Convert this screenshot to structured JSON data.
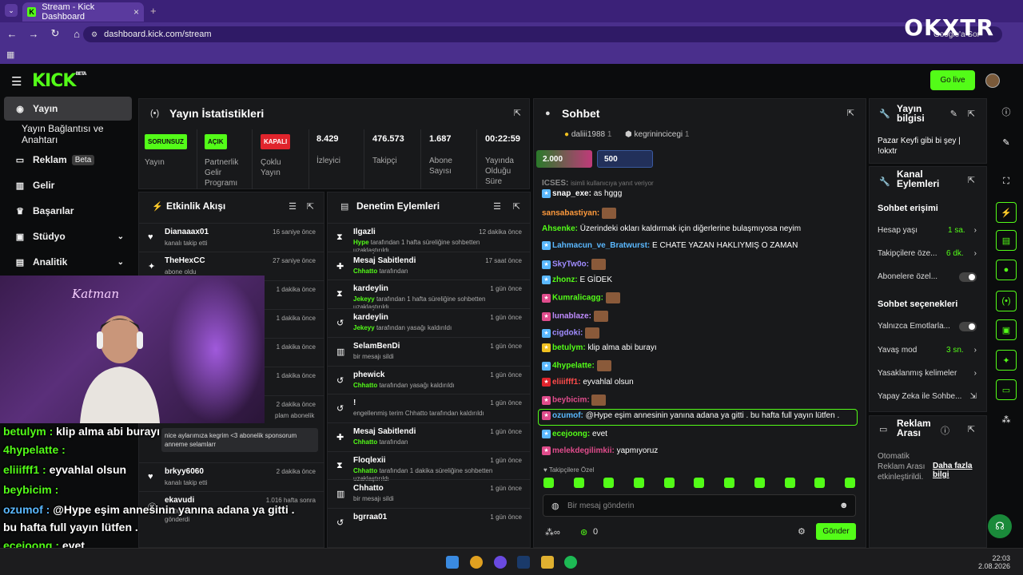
{
  "browser": {
    "tab_title": "Stream - Kick Dashboard",
    "url": "dashboard.kick.com/stream",
    "google_search": "Google'a Sor",
    "watermark": "OKXTR"
  },
  "header": {
    "logo": "KICK",
    "logo_beta": "BETA",
    "golive": "Go live"
  },
  "sidebar": {
    "items": [
      {
        "label": "Yayın",
        "icon": "broadcast-icon",
        "active": true
      },
      {
        "label": "Yayın Bağlantısı ve Anahtarı"
      },
      {
        "label": "Reklam",
        "icon": "ad-icon",
        "badge": "Beta"
      },
      {
        "label": "Gelir",
        "icon": "chart-icon"
      },
      {
        "label": "Başarılar",
        "icon": "trophy-icon"
      },
      {
        "label": "Stüdyo",
        "icon": "studio-icon"
      },
      {
        "label": "Analitik",
        "icon": "analytics-icon"
      }
    ]
  },
  "stats": {
    "title": "Yayın İstatistikleri",
    "items": [
      {
        "value": "SORUNSUZ",
        "label": "Yayın",
        "color": "#53fc18"
      },
      {
        "value": "AÇIK",
        "label": "Partnerlik Gelir Programı",
        "color": "#53fc18"
      },
      {
        "value": "KAPALI",
        "label": "Çoklu Yayın",
        "color": "#e0242c"
      },
      {
        "value": "8.429",
        "label": "İzleyici"
      },
      {
        "value": "476.573",
        "label": "Takipçi"
      },
      {
        "value": "1.687",
        "label": "Abone Sayısı"
      },
      {
        "value": "00:22:59",
        "label": "Yayında Olduğu Süre"
      }
    ]
  },
  "activity": {
    "title": "Etkinlik Akışı",
    "rows": [
      {
        "name": "Dianaaax01",
        "sub": "kanalı takip etti",
        "time": "16 saniye önce"
      },
      {
        "name": "TheHexCC",
        "sub": "abone oldu",
        "time": "27 saniye önce"
      },
      {
        "name": "",
        "sub": "",
        "time": "1 dakika önce"
      },
      {
        "name": "",
        "sub": "",
        "time": "1 dakika önce"
      },
      {
        "name": "",
        "sub": "",
        "time": "1 dakika önce"
      },
      {
        "name": "",
        "sub": "",
        "time": "1 dakika önce"
      },
      {
        "name": "",
        "sub": "plam abonelik",
        "time": "2 dakika önce"
      }
    ],
    "gift_msg": "nice aylarımıza kegrim <3 abonelik sponsorum anneme selamlarr",
    "rows2": [
      {
        "name": "brkyy6060",
        "sub": "kanalı takip etti",
        "time": "2 dakika önce"
      },
      {
        "name": "ekavudi",
        "sub": "2.000 gönderdi",
        "time": "1.016 hafta sonra"
      }
    ]
  },
  "moderation": {
    "title": "Denetim Eylemleri",
    "rows": [
      {
        "name": "Ilgazli",
        "actor": "Hype",
        "sub": "tarafından 1 hafta süreliğine sohbetten uzaklaştırıldı",
        "time": "12 dakika önce",
        "icon": "hourglass-icon"
      },
      {
        "name": "Mesaj Sabitlendi",
        "actor": "Chhatto",
        "sub": "tarafından",
        "time": "17 saat önce",
        "icon": "pin-icon"
      },
      {
        "name": "kardeylin",
        "actor": "Jekeyy",
        "sub": "tarafından 1 hafta süreliğine sohbetten uzaklaştırıldı",
        "time": "1 gün önce",
        "icon": "hourglass-icon"
      },
      {
        "name": "kardeylin",
        "actor": "Jekeyy",
        "sub": "tarafından yasağı kaldırıldı",
        "time": "1 gün önce",
        "icon": "undo-icon"
      },
      {
        "name": "SelamBenDi",
        "actor": "",
        "sub": "bir mesajı sildi",
        "time": "1 gün önce",
        "icon": "trash-icon"
      },
      {
        "name": "phewick",
        "actor": "Chhatto",
        "sub": "tarafından yasağı kaldırıldı",
        "time": "1 gün önce",
        "icon": "undo-icon"
      },
      {
        "name": "!",
        "actor": "",
        "sub": "engellenmiş terim Chhatto tarafından kaldırıldı",
        "time": "1 gün önce",
        "icon": "undo-icon"
      },
      {
        "name": "Mesaj Sabitlendi",
        "actor": "Chhatto",
        "sub": "tarafından",
        "time": "1 gün önce",
        "icon": "pin-icon"
      },
      {
        "name": "Floqlexii",
        "actor": "Chhatto",
        "sub": "tarafından 1 dakika süreliğine sohbetten uzaklaştırıldı",
        "time": "1 gün önce",
        "icon": "hourglass-icon"
      },
      {
        "name": "Chhatto",
        "actor": "",
        "sub": "bir mesajı sildi",
        "time": "1 gün önce",
        "icon": "trash-icon"
      },
      {
        "name": "bgrraa01",
        "actor": "",
        "sub": "",
        "time": "1 gün önce",
        "icon": "undo-icon"
      }
    ]
  },
  "chat": {
    "title": "Sohbet",
    "top_users": [
      {
        "name": "daliii1988",
        "count": "1"
      },
      {
        "name": "kegrinincicegi",
        "count": "1"
      }
    ],
    "goals": [
      {
        "value": "2.000"
      },
      {
        "value": "500"
      }
    ],
    "reply_note": "isimli kullanıcıya yanıt veriyor",
    "messages": [
      {
        "user": "ICSES:",
        "text": "",
        "color": "#888"
      },
      {
        "user": "snap_exe:",
        "text": "as hggg",
        "color": "#fff",
        "badge": "#5ab8ff"
      },
      {
        "user": "sansabastiyan:",
        "text": "",
        "color": "#ff9a3c",
        "emote": true
      },
      {
        "user": "Ahsenke:",
        "text": "Üzerindeki okları kaldırmak için diğerlerine bulaşmıyosa neyim",
        "color": "#53fc18"
      },
      {
        "user": "Lahmacun_ve_Bratwurst:",
        "text": "E CHATE YAZAN HAKLIYMIŞ O ZAMAN",
        "color": "#5ab8ff",
        "badge": "#5ab8ff"
      },
      {
        "user": "SkyTw0o:",
        "text": "",
        "color": "#a08cff",
        "badge": "#5ab8ff",
        "emote": true
      },
      {
        "user": "zhonz:",
        "text": "E GİDEK",
        "color": "#53fc18",
        "badge": "#5ab8ff"
      },
      {
        "user": "Kumralicagg:",
        "text": "",
        "color": "#53fc18",
        "badge": "#e04c8c",
        "emote": true
      },
      {
        "user": "lunablaze:",
        "text": "",
        "color": "#c08cff",
        "badge": "#e04c8c",
        "emote": true
      },
      {
        "user": "cigdoki:",
        "text": "",
        "color": "#a08cff",
        "badge": "#5ab8ff",
        "emote": true
      },
      {
        "user": "betulym:",
        "text": "klip alma abi burayı",
        "color": "#53fc18",
        "badge": "#f0c020"
      },
      {
        "user": "4hypelatte:",
        "text": "",
        "color": "#53fc18",
        "badge": "#5ab8ff",
        "emote": true
      },
      {
        "user": "eliiifff1:",
        "text": "eyvahlal olsun",
        "color": "#ff4c4c",
        "badge": "#e0242c"
      },
      {
        "user": "beybicim:",
        "text": "",
        "color": "#e04c8c",
        "badge": "#e04c8c",
        "emote": true
      },
      {
        "user": "ozumof:",
        "text": "@Hype eşim annesinin yanına adana ya gitti . bu hafta full yayın lütfen .",
        "color": "#5ab8ff",
        "badge": "#e04c8c",
        "highlight": true
      },
      {
        "user": "ecejoong:",
        "text": "evet",
        "color": "#53fc18",
        "badge": "#5ab8ff"
      },
      {
        "user": "melekdegilimkii:",
        "text": "yapmıyoruz",
        "color": "#e04c8c",
        "badge": "#e04c8c"
      }
    ],
    "follower_only": "Takipçilere Özel",
    "input_placeholder": "Bir mesaj gönderin",
    "points": "0",
    "send": "Gönder"
  },
  "stream_info": {
    "title": "Yayın bilgisi",
    "text": "Pazar Keyfi gibi bi şey | !okxtr"
  },
  "channel_actions": {
    "title": "Kanal Eylemleri",
    "access_head": "Sohbet erişimi",
    "access": [
      {
        "label": "Hesap yaşı",
        "value": "1 sa.",
        "kind": "chev"
      },
      {
        "label": "Takipçilere öze...",
        "value": "6 dk.",
        "kind": "chev"
      },
      {
        "label": "Abonelere özel...",
        "kind": "toggle"
      }
    ],
    "options_head": "Sohbet seçenekleri",
    "options": [
      {
        "label": "Yalnızca Emotlarla...",
        "kind": "toggle"
      },
      {
        "label": "Yavaş mod",
        "value": "3 sn.",
        "kind": "chev"
      },
      {
        "label": "Yasaklanmış kelimeler",
        "kind": "chev"
      },
      {
        "label": "Yapay Zeka ile Sohbe...",
        "kind": "ext"
      }
    ]
  },
  "ad_break": {
    "title": "Reklam Arası",
    "text": "Otomatik Reklam Arası etkinleştirildi.",
    "link": "Daha fazla bilgi"
  },
  "overlay_chat": [
    {
      "user": "betulym :",
      "text": "klip alma abi burayı",
      "cls": "ug"
    },
    {
      "user": "4hypelatte :",
      "text": "",
      "cls": "ug"
    },
    {
      "user": "eliiifff1 :",
      "text": "eyvahlal olsun",
      "cls": "ug"
    },
    {
      "user": "beybicim :",
      "text": "",
      "cls": "ug"
    },
    {
      "user": "ozumof :",
      "text": "@Hype eşim annesinin yanına adana ya gitti .",
      "cls": "up"
    },
    {
      "user": "",
      "text": "bu hafta full yayın lütfen .",
      "cls": ""
    },
    {
      "user": "ecejoong :",
      "text": "evet",
      "cls": "ug"
    },
    {
      "user": "melekdegilimkii :",
      "text": "yapmıyoruz",
      "cls": "ug"
    }
  ],
  "cam_sign": "Katman",
  "taskbar": {
    "time": "22:03",
    "date": "2.08.2026"
  }
}
